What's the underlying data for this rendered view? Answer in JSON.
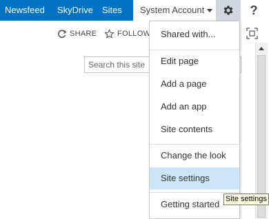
{
  "suite_bar": {
    "links": [
      "Newsfeed",
      "SkyDrive",
      "Sites"
    ],
    "account_label": "System Account",
    "settings_icon": "gear-icon",
    "help_label": "?"
  },
  "actions": {
    "share_label": "SHARE",
    "follow_label": "FOLLOW"
  },
  "search": {
    "placeholder": "Search this site"
  },
  "settings_menu": {
    "groups": [
      [
        "Shared with..."
      ],
      [
        "Edit page",
        "Add a page",
        "Add an app",
        "Site contents"
      ],
      [
        "Change the look",
        "Site settings"
      ],
      [
        "Getting started"
      ]
    ],
    "highlighted_item": "Site settings"
  },
  "tooltip": "Site settings",
  "colors": {
    "suite_bar_blue": "#0072c6",
    "menu_highlight": "#cde6f7"
  }
}
